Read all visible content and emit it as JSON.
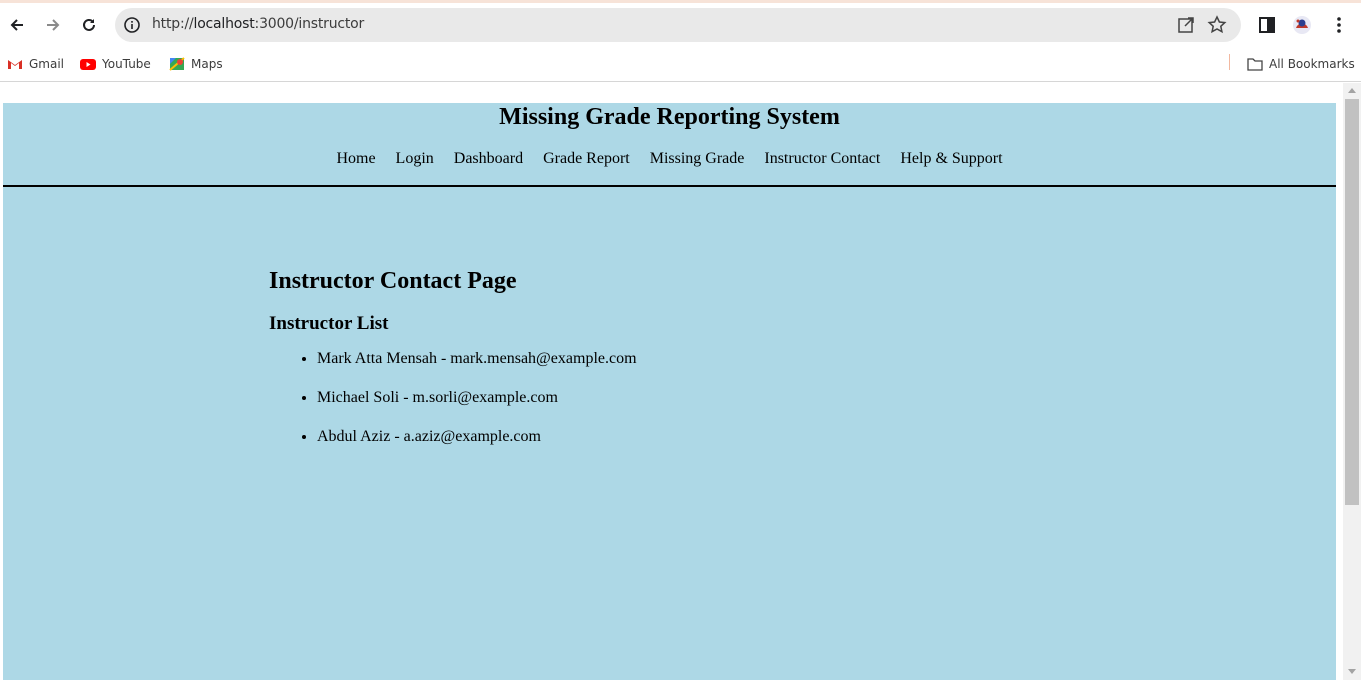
{
  "browser": {
    "url_prefix": "http://",
    "url_host": "localhost",
    "url_rest": ":3000/instructor",
    "bookmarks": [
      {
        "label": "Gmail",
        "icon": "gmail-icon"
      },
      {
        "label": "YouTube",
        "icon": "youtube-icon"
      },
      {
        "label": "Maps",
        "icon": "maps-icon"
      }
    ],
    "all_bookmarks_label": "All Bookmarks"
  },
  "site": {
    "title": "Missing Grade Reporting System",
    "nav": [
      "Home",
      "Login",
      "Dashboard",
      "Grade Report",
      "Missing Grade",
      "Instructor Contact",
      "Help & Support"
    ]
  },
  "main": {
    "page_title": "Instructor Contact Page",
    "list_heading": "Instructor List",
    "instructors": [
      "Mark Atta Mensah - mark.mensah@example.com",
      "Michael Soli - m.sorli@example.com",
      "Abdul Aziz - a.aziz@example.com"
    ]
  },
  "colors": {
    "page_background": "#add8e6",
    "omnibox_background": "#e9e9e9"
  }
}
